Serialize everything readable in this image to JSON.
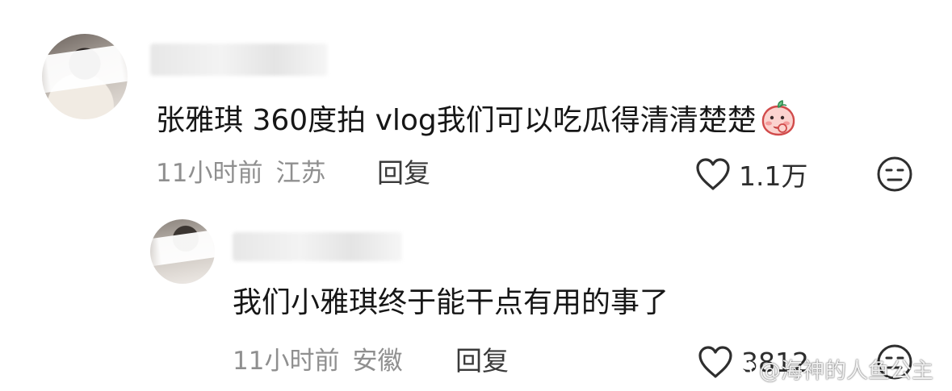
{
  "comments": [
    {
      "username": "■■■■■",
      "text": "张雅琪 360度拍 vlog我们可以吃瓜得清清楚楚",
      "emoji": "peach-sticker",
      "time": "11小时前",
      "location": "江苏",
      "reply_label": "回复",
      "likes": "1.1万"
    },
    {
      "username": "■■■■■",
      "text": "我们小雅琪终于能干点有用的事了",
      "time": "11小时前",
      "location": "安徽",
      "reply_label": "回复",
      "likes": "3812"
    }
  ],
  "watermark": {
    "text": "@海神的人鱼公主"
  },
  "icons": {
    "like": "heart-outline-icon",
    "dislike": "neutral-face-icon",
    "watermark_logo": "weibo-logo-icon"
  },
  "colors": {
    "text_primary": "#161616",
    "text_meta": "#8f8f8f",
    "background": "#ffffff"
  }
}
